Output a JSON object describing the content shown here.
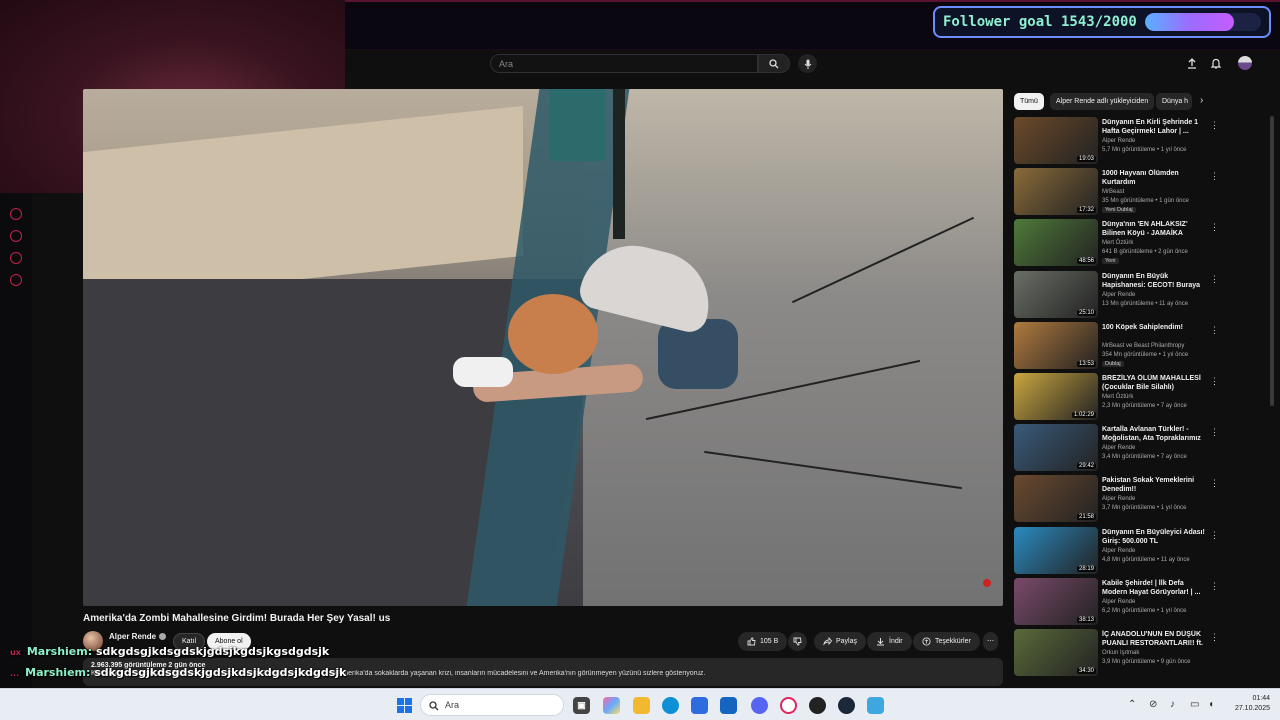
{
  "overlay": {
    "goal_text": "Follower goal 1543/2000",
    "goal_progress": 0.7715,
    "chat": [
      {
        "badge": "ux",
        "user": "Marshiem:",
        "message": "sdkgdsgjkdsgdskjgdsjkgdsjkgsdgdsjk"
      },
      {
        "badge": "...",
        "user": "Marshiem:",
        "message": "sdkgdsgjkdsgdskjgdsjkdsjkdgdsjkdgdsjk"
      }
    ]
  },
  "youtube": {
    "search_placeholder": "Ara",
    "video": {
      "title": "Amerika'da Zombi Mahallesine Girdim! Burada Her Şey Yasal! us",
      "channel": "Alper Rende",
      "join_label": "Katıl",
      "subscribe_label": "Abone ol",
      "likes": "105 B",
      "share_label": "Paylaş",
      "download_label": "İndir",
      "thanks_label": "Teşekkürler",
      "desc_meta": "2.963.395 görüntüleme  2 gün önce",
      "desc_text": "Kensington, Philadelphia. Bütün medyanın 'zombi diyarı' dediği yer. Bu videoda Amerika'da sokaklarda yaşanan krizi, insanların mücadelesini ve Amerika'nın görünmeyen yüzünü sizlere gösteriyoruz."
    },
    "chips": [
      "Tümü",
      "Alper Rende adlı yükleyiciden",
      "Dünya h"
    ],
    "recommendations": [
      {
        "title": "Dünyanın En Kirli Şehrinde 1 Hafta Geçirmek! Lahor | ...",
        "channel": "Alper Rende",
        "meta": "5,7 Mn görüntüleme • 1 yıl önce",
        "duration": "19:03",
        "badge": "",
        "thumb": "#6b4a2a"
      },
      {
        "title": "1000 Hayvanı Ölümden Kurtardım",
        "channel": "MrBeast",
        "meta": "35 Mn görüntüleme • 1 gün önce",
        "duration": "17:32",
        "badge": "Yeni  Dublaj",
        "thumb": "#8a6b3a"
      },
      {
        "title": "Dünya'nın 'EN AHLAKSIZ' Bilinen Köyü - JAMAİKA",
        "channel": "Mert Öztürk",
        "meta": "641 B görüntüleme • 2 gün önce",
        "duration": "48:56",
        "badge": "Yeni",
        "thumb": "#4f7a3a"
      },
      {
        "title": "Dünyanın En Büyük Hapishanesi: CECOT! Buraya ...",
        "channel": "Alper Rende",
        "meta": "13 Mn görüntüleme • 11 ay önce",
        "duration": "25:10",
        "badge": "",
        "thumb": "#6a6f66"
      },
      {
        "title": "100 Köpek Sahiplendim!",
        "channel": "MrBeast ve Beast Philanthropy",
        "meta": "354 Mn görüntüleme • 1 yıl önce",
        "duration": "13:53",
        "badge": "Dublaj",
        "thumb": "#b07a3e"
      },
      {
        "title": "BREZİLYA ÖLÜM MAHALLESİ (Çocuklar Bile Silahlı)",
        "channel": "Mert Öztürk",
        "meta": "2,3 Mn görüntüleme • 7 ay önce",
        "duration": "1:02:29",
        "badge": "",
        "thumb": "#c9a640"
      },
      {
        "title": "Kartalla Avlanan Türkler! - Moğolistan, Ata Topraklarımız",
        "channel": "Alper Rende",
        "meta": "3,4 Mn görüntüleme • 7 ay önce",
        "duration": "29:42",
        "badge": "",
        "thumb": "#3a5a7a"
      },
      {
        "title": "Pakistan Sokak Yemeklerini Denedim!!",
        "channel": "Alper Rende",
        "meta": "3,7 Mn görüntüleme • 1 yıl önce",
        "duration": "21:58",
        "badge": "",
        "thumb": "#6a4a30"
      },
      {
        "title": "Dünyanın En Büyüleyici Adası! Giriş: 500.000 TL",
        "channel": "Alper Rende",
        "meta": "4,8 Mn görüntüleme • 11 ay önce",
        "duration": "28:19",
        "badge": "",
        "thumb": "#2a8ac0"
      },
      {
        "title": "Kabile Şehirde! | İlk Defa Modern Hayat Görüyorlar! | ...",
        "channel": "Alper Rende",
        "meta": "6,2 Mn görüntüleme • 1 yıl önce",
        "duration": "38:13",
        "badge": "",
        "thumb": "#7a4a6a"
      },
      {
        "title": "İÇ ANADOLU'NUN EN DÜŞÜK PUANLI RESTORANTLARI!! ft. ...",
        "channel": "Orkun Işıtmak",
        "meta": "3,9 Mn görüntüleme • 9 gün önce",
        "duration": "34:30",
        "badge": "",
        "thumb": "#5a6a3a"
      }
    ]
  },
  "taskbar": {
    "search_placeholder": "Ara",
    "time": "01:44",
    "date": "27.10.2025"
  }
}
